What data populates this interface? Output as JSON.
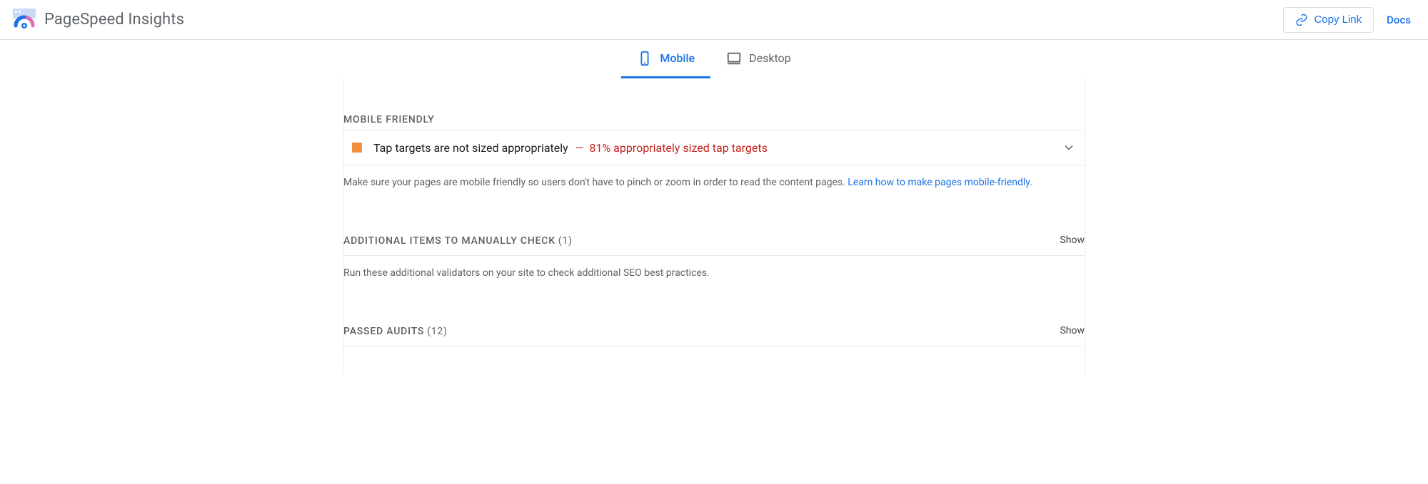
{
  "header": {
    "app_title": "PageSpeed Insights",
    "copy_link_label": "Copy Link",
    "docs_label": "Docs"
  },
  "tabs": {
    "mobile_label": "Mobile",
    "desktop_label": "Desktop",
    "active": "mobile"
  },
  "sections": {
    "mobile_friendly": {
      "title": "MOBILE FRIENDLY",
      "audit": {
        "title": "Tap targets are not sized appropriately",
        "dash": "—",
        "detail": "81% appropriately sized tap targets",
        "status": "warning"
      },
      "desc_text": "Make sure your pages are mobile friendly so users don't have to pinch or zoom in order to read the content pages. ",
      "learn_link": "Learn how to make pages mobile-friendly",
      "period": "."
    },
    "manual_check": {
      "title": "ADDITIONAL ITEMS TO MANUALLY CHECK",
      "count": "(1)",
      "show_label": "Show",
      "desc_text": "Run these additional validators on your site to check additional SEO best practices."
    },
    "passed_audits": {
      "title": "PASSED AUDITS",
      "count": "(12)",
      "show_label": "Show"
    }
  }
}
